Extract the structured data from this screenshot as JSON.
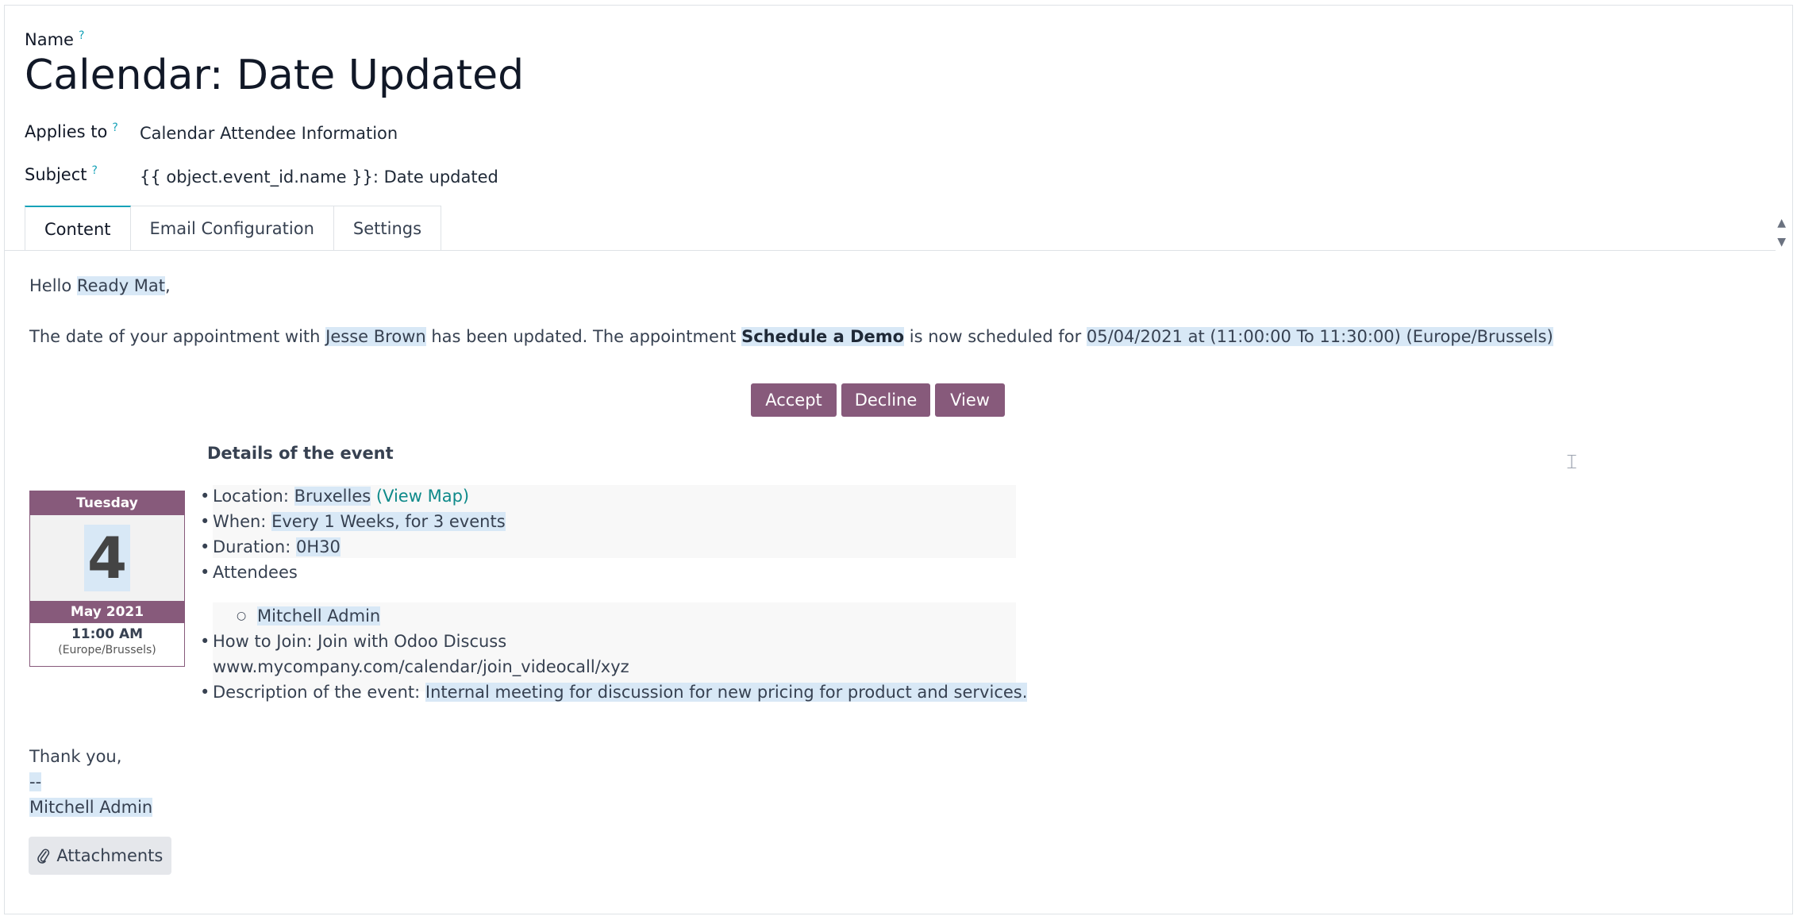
{
  "form": {
    "name_label": "Name",
    "help_mark": "?",
    "name_value": "Calendar: Date Updated",
    "applies_label": "Applies to",
    "applies_value": "Calendar Attendee Information",
    "subject_label": "Subject",
    "subject_value": "{{ object.event_id.name }}: Date updated"
  },
  "tabs": [
    {
      "label": "Content",
      "active": true
    },
    {
      "label": "Email Configuration",
      "active": false
    },
    {
      "label": "Settings",
      "active": false
    }
  ],
  "scroll": {
    "up": "▲",
    "down": "▼"
  },
  "content": {
    "hello": "Hello",
    "recipient": "Ready Mat",
    "comma": ",",
    "line1_a": "The date of your appointment with",
    "organizer": "Jesse Brown",
    "line1_b": "has been updated. The appointment",
    "appointment": "Schedule a Demo",
    "line1_c": "is now scheduled for",
    "schedule": "05/04/2021 at (11:00:00 To 11:30:00) (Europe/Brussels)",
    "buttons": {
      "accept": "Accept",
      "decline": "Decline",
      "view": "View"
    },
    "details_title": "Details of the event",
    "calendar": {
      "weekday": "Tuesday",
      "day": "4",
      "month_year": "May 2021",
      "time": "11:00 AM",
      "timezone": "(Europe/Brussels)"
    },
    "details": {
      "location_label": "Location:",
      "location": "Bruxelles",
      "view_map": "(View Map)",
      "when_label": "When:",
      "when": "Every 1 Weeks, for 3 events",
      "duration_label": "Duration:",
      "duration": "0H30",
      "attendees_label": "Attendees",
      "attendee": "Mitchell Admin",
      "join_label": "How to Join: Join with Odoo Discuss",
      "join_url": "www.mycompany.com/calendar/join_videocall/xyz",
      "description_label": "Description of the event:",
      "description": "Internal meeting for discussion for new pricing for product and services."
    },
    "closing": "Thank you,",
    "sig_sep": "--",
    "signature": "Mitchell Admin"
  },
  "attachments": {
    "label": "Attachments"
  },
  "colors": {
    "brand": "#875a7b",
    "link": "#0e8a8a",
    "help": "#17a2b8",
    "highlight": "#d8e8f6"
  }
}
